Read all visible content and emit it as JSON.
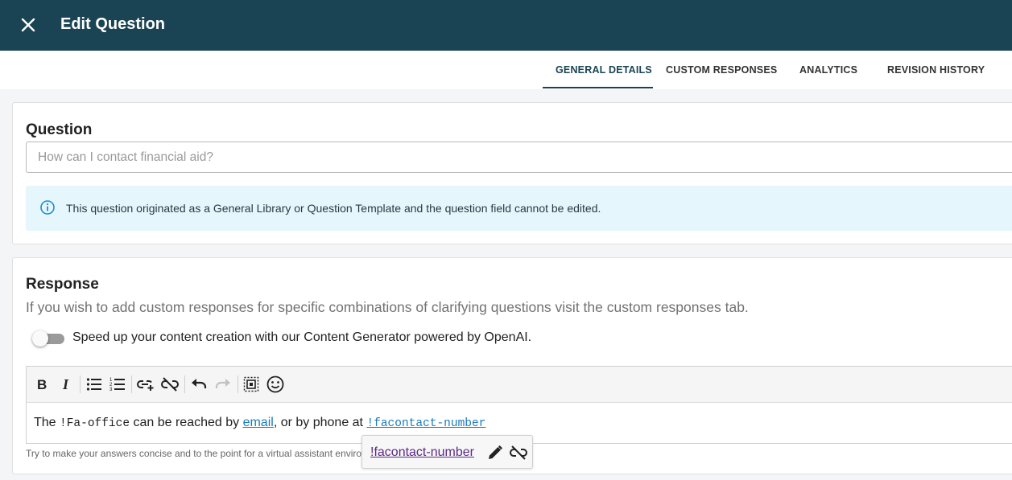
{
  "header": {
    "title": "Edit Question",
    "close_icon": "close-icon",
    "bg_color": "#1a4453"
  },
  "tabs": [
    {
      "label": "GENERAL DETAILS",
      "active": true
    },
    {
      "label": "CUSTOM RESPONSES",
      "active": false
    },
    {
      "label": "ANALYTICS",
      "active": false
    },
    {
      "label": "REVISION HISTORY",
      "active": false
    }
  ],
  "question": {
    "heading": "Question",
    "placeholder": "How can I contact financial aid?",
    "value": "",
    "notice": "This question originated as a General Library or Question Template and the question field cannot be edited.",
    "notice_icon": "info-icon"
  },
  "response": {
    "heading": "Response",
    "subtitle": "If you wish to add custom responses for specific combinations of clarifying questions visit the custom responses tab.",
    "toggle": {
      "label": "Speed up your content creation with our Content Generator powered by OpenAI.",
      "on": false
    },
    "toolbar": [
      "bold-icon",
      "italic-icon",
      "bullet-list-icon",
      "numbered-list-icon",
      "insert-link-icon",
      "unlink-icon",
      "undo-icon",
      "redo-icon",
      "select-all-icon",
      "emoji-icon"
    ],
    "content": {
      "part1": "The ",
      "code1": "!Fa-office",
      "part2": " can be reached by ",
      "link1": "email",
      "part3": ", or by phone at ",
      "link2": "!facontact-number"
    },
    "hint": "Try to make your answers concise and to the point for a virtual assistant enviro"
  },
  "link_popover": {
    "link_text": "!facontact-number",
    "edit_icon": "pencil-icon",
    "unlink_icon": "unlink-icon"
  },
  "colors": {
    "accent": "#1a4453",
    "link": "#1a7bbf",
    "visited_link": "#5b2a86",
    "notice_bg": "#e5f6fc"
  }
}
